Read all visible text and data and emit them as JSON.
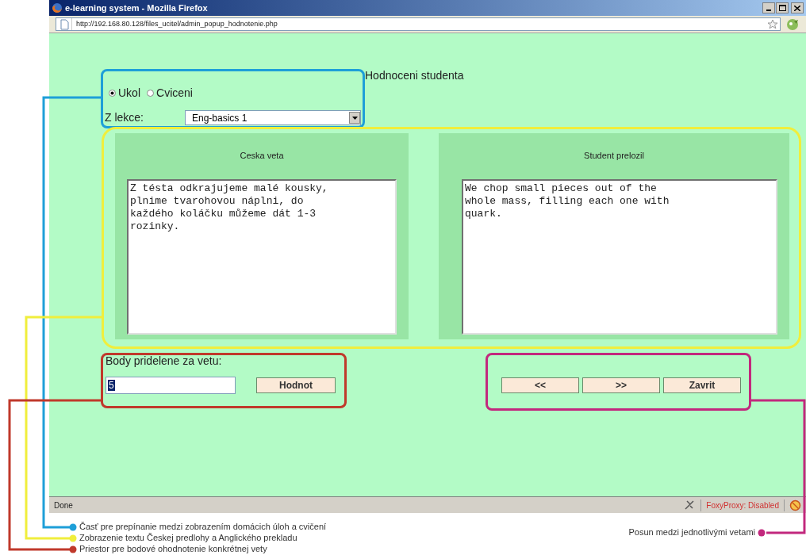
{
  "window": {
    "title": "e-learning system - Mozilla Firefox"
  },
  "address_bar": {
    "url": "http://192.168.80.128/files_ucitel/admin_popup_hodnotenie.php"
  },
  "page": {
    "heading": "Hodnoceni studenta",
    "mode_options": [
      {
        "label": "Ukol",
        "selected": true
      },
      {
        "label": "Cviceni",
        "selected": false
      }
    ],
    "lesson": {
      "label": "Z lekce:",
      "value": "Eng-basics 1"
    },
    "panels": [
      {
        "title": "Ceska veta",
        "text": "Z tésta odkrajujeme malé kousky, plnime tvarohovou náplni, do každého koláčku můžeme dát 1-3 rozinky."
      },
      {
        "title": "Student prelozil",
        "text": "We chop small pieces out of the whole mass, filling each one with quark."
      }
    ],
    "points": {
      "label": "Body pridelene za vetu:",
      "value": "5",
      "button": "Hodnot"
    },
    "nav_buttons": [
      "<<",
      ">>",
      "Zavrit"
    ]
  },
  "status_bar": {
    "text": "Done",
    "proxy": "FoxyProxy: Disabled"
  },
  "annotations": [
    {
      "text": "Časť pre prepínanie medzi zobrazením domácich úloh a cvičení",
      "color": "#1e9fd8"
    },
    {
      "text": "Zobrazenie textu Českej predlohy a Anglického prekladu",
      "color": "#f0ee3c"
    },
    {
      "text": "Priestor pre bodové ohodnotenie konkrétnej vety",
      "color": "#c0392b"
    },
    {
      "text": "Posun medzi jednotlivými vetami",
      "color": "#c2287d"
    }
  ]
}
